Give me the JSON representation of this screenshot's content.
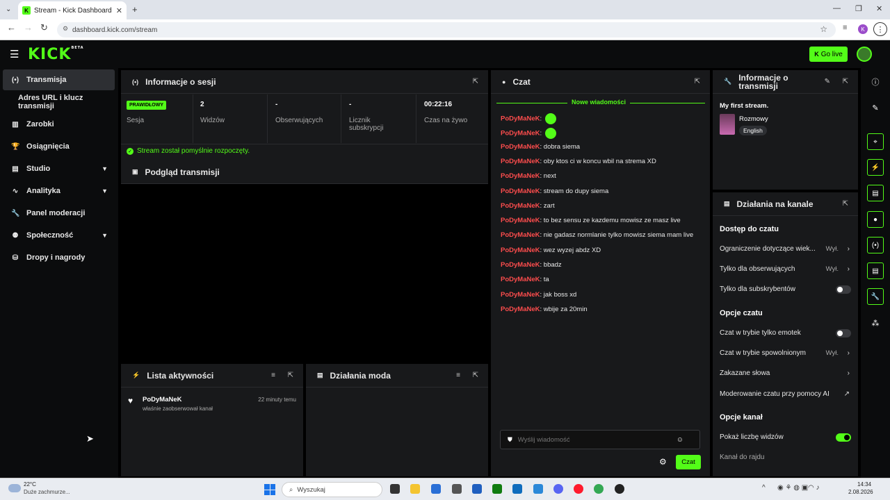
{
  "browser": {
    "tab_title": "Stream - Kick Dashboard",
    "url": "dashboard.kick.com/stream"
  },
  "header": {
    "logo": "KICK",
    "beta": "BETA",
    "go_live": "Go live"
  },
  "nav": {
    "items": [
      {
        "label": "Transmisja",
        "icon": "broadcast-icon"
      },
      {
        "label": "Adres URL i klucz transmisji",
        "icon": ""
      },
      {
        "label": "Zarobki",
        "icon": "chart-icon"
      },
      {
        "label": "Osiągnięcia",
        "icon": "trophy-icon"
      },
      {
        "label": "Studio",
        "icon": "studio-icon"
      },
      {
        "label": "Analityka",
        "icon": "analytics-icon"
      },
      {
        "label": "Panel moderacji",
        "icon": "wrench-icon"
      },
      {
        "label": "Społeczność",
        "icon": "community-icon"
      },
      {
        "label": "Dropy i nagrody",
        "icon": "drops-icon"
      }
    ]
  },
  "session": {
    "title": "Informacje o sesji",
    "status_badge": "PRAWIDŁOWY",
    "status_label": "Sesja",
    "viewers_value": "2",
    "viewers_label": "Widzów",
    "followers_value": "-",
    "followers_label": "Obserwujących",
    "subs_value": "-",
    "subs_label": "Licznik subskrypcji",
    "uptime_value": "00:22:16",
    "uptime_label": "Czas na żywo",
    "success_message": "Stream został pomyślnie rozpoczęty."
  },
  "preview": {
    "title": "Podgląd transmisji"
  },
  "activity": {
    "title": "Lista aktywności",
    "items": [
      {
        "user": "PoDyMaNeK",
        "text": "właśnie zaobserwował kanał",
        "time": "22 minuty temu"
      }
    ]
  },
  "modactions": {
    "title": "Działania moda"
  },
  "chat": {
    "title": "Czat",
    "new_messages": "Nowe wiadomości",
    "messages": [
      {
        "user": "PoDyMaNeK",
        "text": ""
      },
      {
        "user": "PoDyMaNeK",
        "text": ""
      },
      {
        "user": "PoDyMaNeK",
        "text": "dobra siema"
      },
      {
        "user": "PoDyMaNeK",
        "text": "oby ktos ci w koncu wbil na strema XD"
      },
      {
        "user": "PoDyMaNeK",
        "text": "next"
      },
      {
        "user": "PoDyMaNeK",
        "text": "stream do dupy siema"
      },
      {
        "user": "PoDyMaNeK",
        "text": "zart"
      },
      {
        "user": "PoDyMaNeK",
        "text": "to bez sensu ze kazdemu mowisz ze masz live"
      },
      {
        "user": "PoDyMaNeK",
        "text": "nie gadasz normlanie tylko mowisz siema mam live"
      },
      {
        "user": "PoDyMaNeK",
        "text": "wez wyzej abdz XD"
      },
      {
        "user": "PoDyMaNeK",
        "text": "bbadz"
      },
      {
        "user": "PoDyMaNeK",
        "text": "ta"
      },
      {
        "user": "PoDyMaNeK",
        "text": "jak boss xd"
      },
      {
        "user": "PoDyMaNeK",
        "text": "wbije za 20min"
      }
    ],
    "input_placeholder": "Wyślij wiadomość",
    "send_label": "Czat"
  },
  "stream_info": {
    "title": "Informacje o transmisji",
    "stream_title": "My first stream.",
    "category": "Rozmowy",
    "language": "English"
  },
  "channel_actions": {
    "title": "Działania na kanale",
    "section_chat_access": "Dostęp do czatu",
    "age_restriction": "Ograniczenie dotyczące wiek...",
    "age_restriction_value": "Wył.",
    "followers_only": "Tylko dla obserwujących",
    "followers_only_value": "Wył.",
    "subs_only": "Tylko dla subskrybentów",
    "section_chat_options": "Opcje czatu",
    "emote_only": "Czat w trybie tylko emotek",
    "slow_mode": "Czat w trybie spowolnionym",
    "slow_mode_value": "Wył.",
    "banned_words": "Zakazane słowa",
    "ai_moderation": "Moderowanie czatu przy pomocy AI",
    "section_channel_options": "Opcje kanał",
    "show_viewers": "Pokaż liczbę widzów",
    "raid_channel": "Kanał do rajdu",
    "toggles": {
      "subs_only": false,
      "emote_only": false,
      "show_viewers": true
    }
  },
  "taskbar": {
    "weather_temp": "22°C",
    "weather_desc": "Duże zachmurze...",
    "search": "Wyszukaj",
    "time": "14:34",
    "date": "2.08.2026"
  }
}
